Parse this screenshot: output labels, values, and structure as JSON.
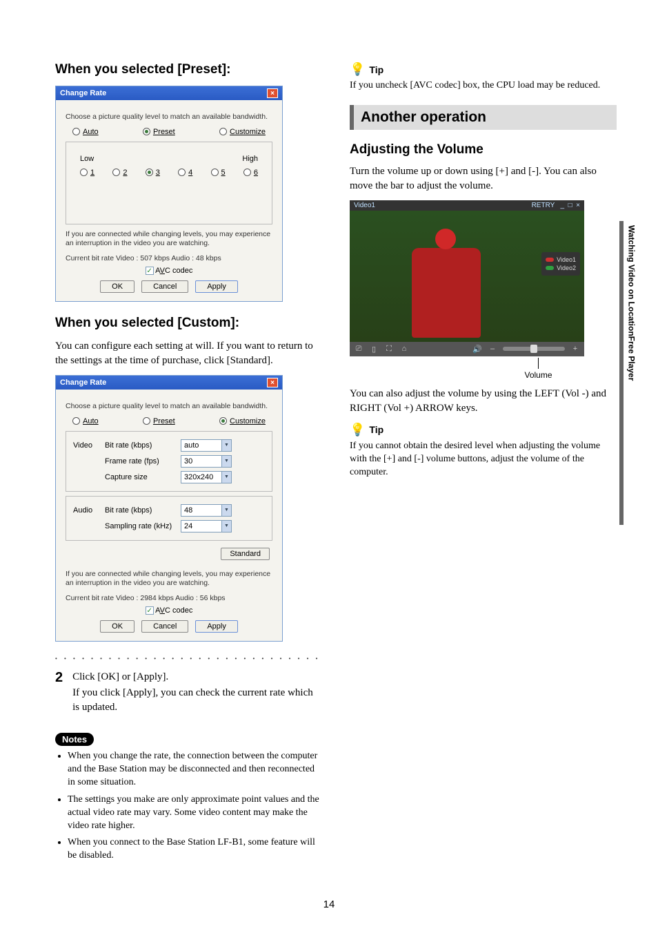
{
  "sideTab": "Watching Video on LocationFree Player",
  "left": {
    "h1": "When you selected [Preset]:",
    "dialog1": {
      "title": "Change Rate",
      "instruction": "Choose a picture quality level to match an available bandwidth.",
      "modes": {
        "auto": "Auto",
        "preset": "Preset",
        "custom": "Customize"
      },
      "low": "Low",
      "high": "High",
      "levels": [
        "1",
        "2",
        "3",
        "4",
        "5",
        "6"
      ],
      "note": "If you are connected while changing levels, you may experience an interruption in the video you are watching.",
      "bitrate": "Current bit rate    Video :        507 kbps   Audio : 48 kbps",
      "avc": "AVC codec",
      "ok": "OK",
      "cancel": "Cancel",
      "apply": "Apply"
    },
    "h2": "When you selected [Custom]:",
    "intro": "You can configure each setting at will. If you want to return to the settings at the time of purchase, click [Standard].",
    "dialog2": {
      "title": "Change Rate",
      "instruction": "Choose a picture quality level to match an available bandwidth.",
      "modes": {
        "auto": "Auto",
        "preset": "Preset",
        "custom": "Customize"
      },
      "video": "Video",
      "audio": "Audio",
      "fields": {
        "vBit": {
          "label": "Bit rate (kbps)",
          "value": "auto"
        },
        "vFps": {
          "label": "Frame rate (fps)",
          "value": "30"
        },
        "vCap": {
          "label": "Capture size",
          "value": "320x240"
        },
        "aBit": {
          "label": "Bit rate (kbps)",
          "value": "48"
        },
        "aSamp": {
          "label": "Sampling rate (kHz)",
          "value": "24"
        }
      },
      "standard": "Standard",
      "note": "If you are connected while changing levels, you may experience an interruption in the video you are watching.",
      "bitrate": "Current bit rate    Video :      2984 kbps   Audio : 56 kbps",
      "avc": "AVC codec",
      "ok": "OK",
      "cancel": "Cancel",
      "apply": "Apply"
    },
    "step": {
      "num": "2",
      "text": "Click [OK] or [Apply].",
      "text2": "If you click [Apply], you can check the current rate which is updated."
    },
    "notesTitle": "Notes",
    "notes": [
      "When you change the rate, the connection between the computer and the Base Station may be disconnected and then reconnected in some situation.",
      "The settings you make are only approximate point values and the actual video rate may vary. Some video content may make the video rate higher.",
      "When you connect to the Base Station LF-B1, some feature will be disabled."
    ]
  },
  "right": {
    "tip1": {
      "label": "Tip",
      "body": "If you uncheck [AVC codec] box, the CPU load may be reduced."
    },
    "banner": "Another operation",
    "sub": "Adjusting the Volume",
    "intro": "Turn the volume up or down using [+] and [-]. You can also move the bar to adjust the volume.",
    "video": {
      "title": "Video1",
      "status": "RETRY",
      "legend1": "Video1",
      "legend2": "Video2",
      "caption": "Volume"
    },
    "after": "You can also adjust the volume by using the LEFT (Vol -) and RIGHT (Vol +) ARROW keys.",
    "tip2": {
      "label": "Tip",
      "body": "If you cannot obtain the desired level when adjusting the volume with the [+] and [-] volume buttons, adjust the volume of the computer."
    }
  },
  "pageNumber": "14"
}
